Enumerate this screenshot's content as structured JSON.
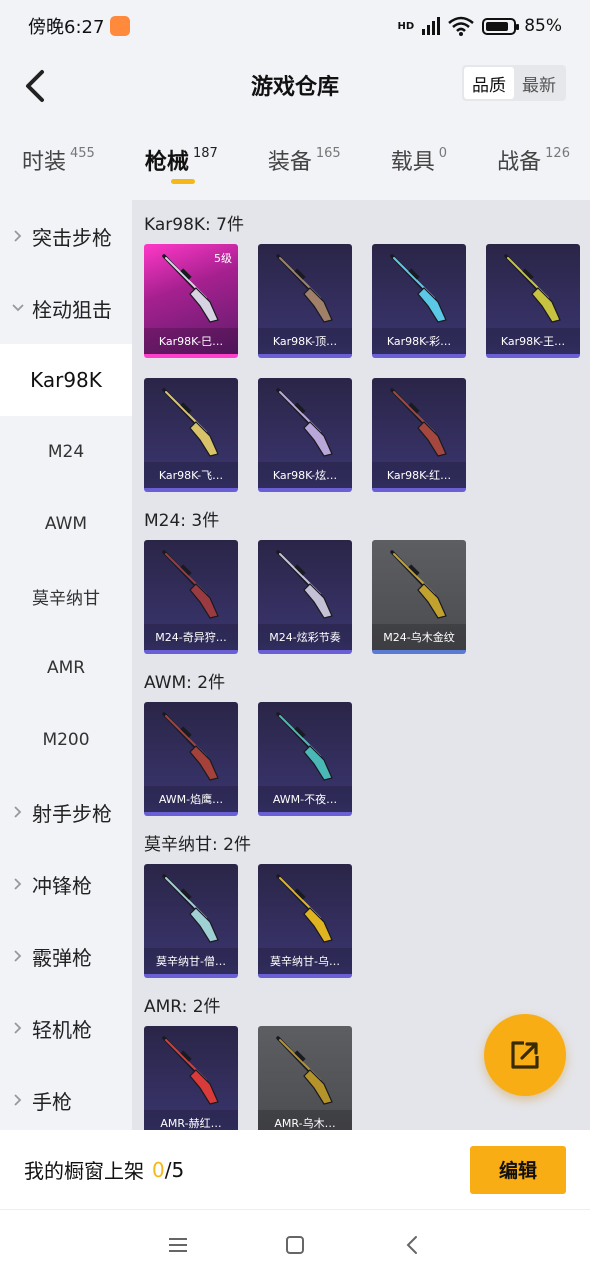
{
  "status": {
    "time": "傍晚6:27",
    "battery": "85%",
    "battery_level": 0.85,
    "network": "HD"
  },
  "header": {
    "title": "游戏仓库",
    "sort_options": [
      "品质",
      "最新"
    ],
    "sort_active": "品质"
  },
  "categories": [
    {
      "label": "时装",
      "count": "455"
    },
    {
      "label": "枪械",
      "count": "187",
      "active": true
    },
    {
      "label": "装备",
      "count": "165"
    },
    {
      "label": "载具",
      "count": "0"
    },
    {
      "label": "战备",
      "count": "126"
    }
  ],
  "sidebar": [
    {
      "label": "突击步枪",
      "type": "group"
    },
    {
      "label": "栓动狙击",
      "type": "group-open"
    },
    {
      "label": "Kar98K",
      "type": "sub",
      "selected": true
    },
    {
      "label": "M24",
      "type": "sub"
    },
    {
      "label": "AWM",
      "type": "sub"
    },
    {
      "label": "莫辛纳甘",
      "type": "sub"
    },
    {
      "label": "AMR",
      "type": "sub"
    },
    {
      "label": "M200",
      "type": "sub"
    },
    {
      "label": "射手步枪",
      "type": "group"
    },
    {
      "label": "冲锋枪",
      "type": "group"
    },
    {
      "label": "霰弹枪",
      "type": "group"
    },
    {
      "label": "轻机枪",
      "type": "group"
    },
    {
      "label": "手枪",
      "type": "group"
    }
  ],
  "sections": [
    {
      "title": "Kar98K: 7件",
      "items": [
        {
          "name": "Kar98K-巳…",
          "level": "5级",
          "style": "legendary",
          "gun_color": "#d8d3e3"
        },
        {
          "name": "Kar98K-顶…",
          "style": "purple",
          "gun_color": "#a08068"
        },
        {
          "name": "Kar98K-彩…",
          "style": "purple",
          "gun_color": "#5bc8e8"
        },
        {
          "name": "Kar98K-王…",
          "style": "purple",
          "gun_color": "#c7c341"
        },
        {
          "name": "Kar98K-飞…",
          "style": "purple",
          "gun_color": "#d9c36a"
        },
        {
          "name": "Kar98K-炫…",
          "style": "purple",
          "gun_color": "#b9a7d9"
        },
        {
          "name": "Kar98K-红…",
          "style": "purple",
          "gun_color": "#a4473f"
        }
      ]
    },
    {
      "title": "M24: 3件",
      "items": [
        {
          "name": "M24-奇异狩…",
          "style": "purple",
          "gun_color": "#9c3a42"
        },
        {
          "name": "M24-炫彩节奏",
          "style": "purple",
          "gun_color": "#c4c0d6"
        },
        {
          "name": "M24-乌木金纹",
          "style": "gray",
          "gun_color": "#c2a22e"
        }
      ]
    },
    {
      "title": "AWM: 2件",
      "items": [
        {
          "name": "AWM-焰鹰…",
          "style": "purple",
          "gun_color": "#a3413a"
        },
        {
          "name": "AWM-不夜…",
          "style": "purple",
          "gun_color": "#4ab8b6"
        }
      ]
    },
    {
      "title": "莫辛纳甘: 2件",
      "items": [
        {
          "name": "莫辛纳甘-僧…",
          "style": "purple",
          "gun_color": "#9fd0d4"
        },
        {
          "name": "莫辛纳甘-乌…",
          "style": "purple",
          "gun_color": "#e0b421"
        }
      ]
    },
    {
      "title": "AMR: 2件",
      "items": [
        {
          "name": "AMR-赫红…",
          "style": "purple",
          "gun_color": "#d93a3a"
        },
        {
          "name": "AMR-乌木…",
          "style": "gray",
          "gun_color": "#b3932a"
        }
      ]
    }
  ],
  "bottom": {
    "label": "我的橱窗上架",
    "count": "0",
    "total": "/5",
    "edit_label": "编辑"
  },
  "icons": {
    "back": "back-arrow-icon",
    "share": "share-external-icon",
    "menu": "menu-icon",
    "home": "home-icon",
    "nav_back": "nav-back-icon"
  }
}
